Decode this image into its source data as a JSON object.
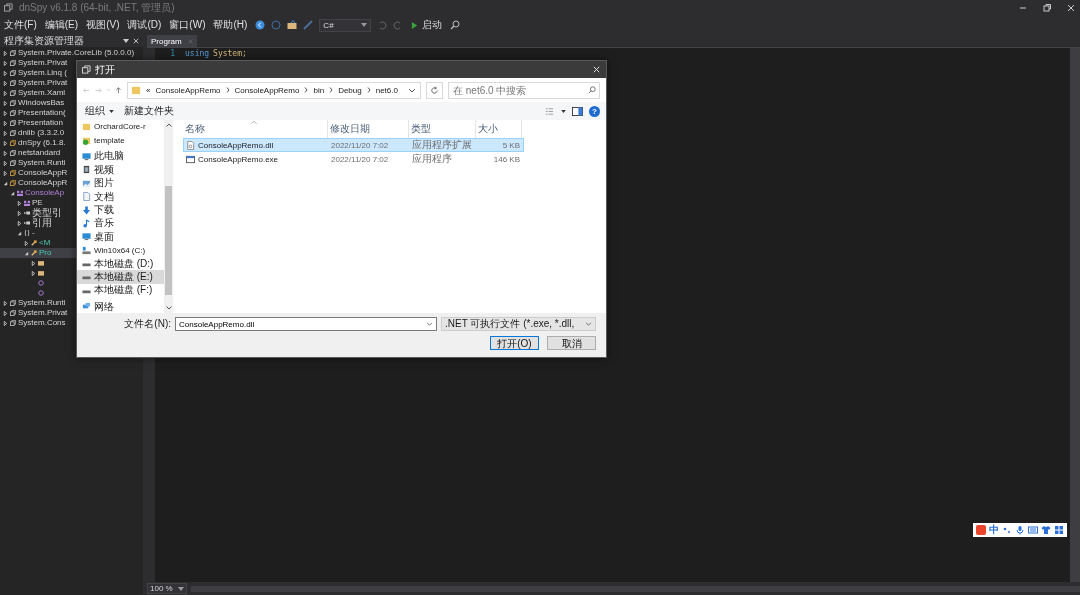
{
  "app": {
    "title": "dnSpy v6.1.8 (64-bit, .NET, 管理员)"
  },
  "menu": [
    "文件(F)",
    "编辑(E)",
    "视图(V)",
    "调试(D)",
    "窗口(W)",
    "帮助(H)"
  ],
  "toolbar": {
    "language": "C#",
    "run_label": "启动"
  },
  "explorer": {
    "title": "程序集资源管理器",
    "tree": [
      {
        "label": "System.Private.CoreLib (5.0.0.0)",
        "kind": "assembly",
        "expanded": false,
        "selected": false
      },
      {
        "label": "System.Privat",
        "kind": "assembly",
        "expanded": false,
        "selected": false
      },
      {
        "label": "System.Linq (",
        "kind": "assembly",
        "expanded": false,
        "selected": false
      },
      {
        "label": "System.Privat",
        "kind": "assembly",
        "expanded": false,
        "selected": false
      },
      {
        "label": "System.Xaml",
        "kind": "assembly",
        "expanded": false,
        "selected": false
      },
      {
        "label": "WindowsBas",
        "kind": "assembly",
        "expanded": false,
        "selected": false
      },
      {
        "label": "Presentation(",
        "kind": "assembly",
        "expanded": false,
        "selected": false
      },
      {
        "label": "Presentation",
        "kind": "assembly",
        "expanded": false,
        "selected": false
      },
      {
        "label": "dnlib (3.3.2.0",
        "kind": "assembly",
        "expanded": false,
        "selected": false
      },
      {
        "label": "dnSpy (6.1.8.",
        "kind": "assembly-gold",
        "expanded": false,
        "selected": false
      },
      {
        "label": "netstandard",
        "kind": "assembly",
        "expanded": false,
        "selected": false
      },
      {
        "label": "System.Runti",
        "kind": "assembly",
        "expanded": false,
        "selected": false
      },
      {
        "label": "ConsoleAppR",
        "kind": "assembly-gold",
        "expanded": false,
        "selected": false
      },
      {
        "label": "ConsoleAppR",
        "kind": "assembly-gold",
        "expanded": true,
        "selected": false,
        "children": [
          {
            "label": "ConsoleAp",
            "kind": "module",
            "expanded": true,
            "selected": false,
            "children": [
              {
                "label": "PE",
                "kind": "pe",
                "expanded": false,
                "selected": false
              },
              {
                "label": "类型引",
                "kind": "refs",
                "expanded": false,
                "selected": false
              },
              {
                "label": "引用",
                "kind": "refs",
                "expanded": false,
                "selected": false
              },
              {
                "label": "-",
                "kind": "namespace",
                "expanded": true,
                "selected": false,
                "children": [
                  {
                    "label": "<M",
                    "kind": "class",
                    "expanded": false,
                    "selected": false
                  },
                  {
                    "label": "Pro",
                    "kind": "class",
                    "expanded": true,
                    "selected": true,
                    "children": [
                      {
                        "kind": "folder",
                        "expanded": false,
                        "selected": false
                      },
                      {
                        "kind": "folder",
                        "expanded": false,
                        "selected": false
                      },
                      {
                        "kind": "method",
                        "selected": false
                      },
                      {
                        "kind": "method",
                        "selected": false
                      }
                    ]
                  }
                ]
              }
            ]
          }
        ]
      },
      {
        "label": "System.Runti",
        "kind": "assembly",
        "expanded": false,
        "selected": false
      },
      {
        "label": "System.Privat",
        "kind": "assembly",
        "expanded": false,
        "selected": false
      },
      {
        "label": "System.Cons",
        "kind": "assembly",
        "expanded": false,
        "selected": false
      }
    ]
  },
  "editor": {
    "tabs": [
      {
        "label": "Program",
        "selected": true
      }
    ],
    "lines": [
      {
        "number": "1",
        "keyword": "using",
        "name": "System;"
      }
    ]
  },
  "zoom": "100 %",
  "dialog": {
    "title": "打开",
    "path": {
      "overflow": "«",
      "segments": [
        "ConsoleAppRemo",
        "ConsoleAppRemo",
        "bin",
        "Debug",
        "net6.0"
      ]
    },
    "search": {
      "placeholder": "在 net6.0 中搜索"
    },
    "organize": "组织",
    "new_folder": "新建文件夹",
    "help": "?",
    "nav": [
      {
        "label": "OrchardCore-r",
        "kind": "folder",
        "selected": false
      },
      {
        "label": "template",
        "kind": "synced",
        "selected": false
      },
      {
        "label": "此电脑",
        "kind": "pc",
        "selected": false
      },
      {
        "label": "视频",
        "kind": "video",
        "selected": false
      },
      {
        "label": "图片",
        "kind": "pictures",
        "selected": false
      },
      {
        "label": "文档",
        "kind": "documents",
        "selected": false
      },
      {
        "label": "下载",
        "kind": "downloads",
        "selected": false
      },
      {
        "label": "音乐",
        "kind": "music",
        "selected": false
      },
      {
        "label": "桌面",
        "kind": "desktop",
        "selected": false
      },
      {
        "label": "Win10x64 (C:)",
        "kind": "system-drive",
        "selected": false
      },
      {
        "label": "本地磁盘 (D:)",
        "kind": "drive",
        "selected": false
      },
      {
        "label": "本地磁盘 (E:)",
        "kind": "drive",
        "selected": true
      },
      {
        "label": "本地磁盘 (F:)",
        "kind": "drive",
        "selected": false
      },
      {
        "label": "网络",
        "kind": "network",
        "selected": false
      }
    ],
    "columns": [
      "名称",
      "修改日期",
      "类型",
      "大小"
    ],
    "files": [
      {
        "name": "ConsoleAppRemo.dll",
        "kind": "dll",
        "date": "2022/11/20 7:02",
        "type": "应用程序扩展",
        "size": "5 KB",
        "selected": true
      },
      {
        "name": "ConsoleAppRemo.exe",
        "kind": "exe",
        "date": "2022/11/20 7:02",
        "type": "应用程序",
        "size": "146 KB",
        "selected": false
      }
    ],
    "filename_label": "文件名(N):",
    "filename": "ConsoleAppRemo.dll",
    "filter": ".NET 可执行文件 (*.exe, *.dll,",
    "buttons": [
      "打开(O)",
      "取消"
    ]
  },
  "ime": {
    "mode": "中"
  }
}
